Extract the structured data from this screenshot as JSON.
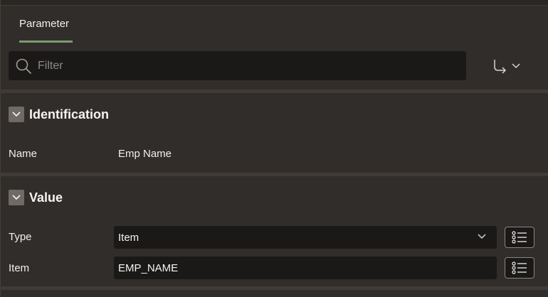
{
  "tabs": [
    {
      "label": "Parameter",
      "active": true
    }
  ],
  "filter": {
    "placeholder": "Filter",
    "value": ""
  },
  "sections": {
    "identification": {
      "title": "Identification",
      "rows": {
        "name": {
          "label": "Name",
          "value": "Emp Name"
        }
      }
    },
    "value": {
      "title": "Value",
      "rows": {
        "type": {
          "label": "Type",
          "value": "Item"
        },
        "item": {
          "label": "Item",
          "value": "EMP_NAME"
        }
      }
    }
  },
  "colors": {
    "background": "#312d2a",
    "field_background": "#1b1917",
    "tab_accent": "#7d9c72",
    "section_separator": "#403b37"
  }
}
